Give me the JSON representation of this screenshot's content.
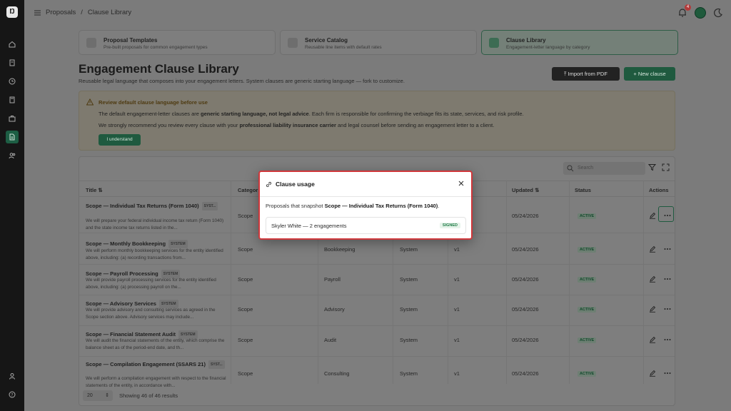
{
  "breadcrumb": {
    "root": "Proposals",
    "separator": "/",
    "current": "Clause Library"
  },
  "notifications": {
    "count": "4"
  },
  "tabs": [
    {
      "title": "Proposal Templates",
      "subtitle": "Pre-built proposals for common engagement types"
    },
    {
      "title": "Service Catalog",
      "subtitle": "Reusable line items with default rates"
    },
    {
      "title": "Clause Library",
      "subtitle": "Engagement-letter language by category",
      "active": true
    }
  ],
  "page": {
    "title": "Engagement Clause Library",
    "subtitle": "Reusable legal language that composes into your engagement letters. System clauses are generic starting language — fork to customize.",
    "import_label": "Import from PDF",
    "new_label": "New clause"
  },
  "warning": {
    "title": "Review default clause language before use",
    "p1_a": "The default engagement-letter clauses are ",
    "p1_b": "generic starting language, not legal advice",
    "p1_c": ". Each firm is responsible for confirming the verbiage fits its state, services, and risk profile.",
    "p2_a": "We strongly recommend you review every clause with your ",
    "p2_b": "professional liability insurance carrier",
    "p2_c": " and legal counsel before sending an engagement letter to a client.",
    "button": "I understand"
  },
  "table": {
    "search_placeholder": "Search",
    "headers": {
      "title": "Title ⇅",
      "category": "Categor",
      "updated": "Updated ⇅",
      "status": "Status",
      "actions": "Actions"
    },
    "rows": [
      {
        "title": "Scope — Individual Tax Returns (Form 1040)",
        "tag": "SYST...",
        "desc": "We will prepare your federal individual income tax return (Form 1040) and the state income tax returns listed in the...",
        "category": "Scope",
        "service": "",
        "owner": "",
        "version": "",
        "updated": "05/24/2026",
        "status": "ACTIVE"
      },
      {
        "title": "Scope — Monthly Bookkeeping",
        "tag": "SYSTEM",
        "desc": "We will perform monthly bookkeeping services for the entity identified above, including: (a) recording transactions from...",
        "category": "Scope",
        "service": "Bookkeeping",
        "owner": "System",
        "version": "v1",
        "updated": "05/24/2026",
        "status": "ACTIVE"
      },
      {
        "title": "Scope — Payroll Processing",
        "tag": "SYSTEM",
        "desc": "We will provide payroll processing services for the entity identified above, including: (a) processing payroll on the...",
        "category": "Scope",
        "service": "Payroll",
        "owner": "System",
        "version": "v1",
        "updated": "05/24/2026",
        "status": "ACTIVE"
      },
      {
        "title": "Scope — Advisory Services",
        "tag": "SYSTEM",
        "desc": "We will provide advisory and consulting services as agreed in the Scope section above. Advisory services may include...",
        "category": "Scope",
        "service": "Advisory",
        "owner": "System",
        "version": "v1",
        "updated": "05/24/2026",
        "status": "ACTIVE"
      },
      {
        "title": "Scope — Financial Statement Audit",
        "tag": "SYSTEM",
        "desc": "We will audit the financial statements of the entity, which comprise the balance sheet as of the period-end date, and th...",
        "category": "Scope",
        "service": "Audit",
        "owner": "System",
        "version": "v1",
        "updated": "05/24/2026",
        "status": "ACTIVE"
      },
      {
        "title": "Scope — Compilation Engagement (SSARS 21)",
        "tag": "SYST...",
        "desc": "We will perform a compilation engagement with respect to the financial statements of the entity, in accordance with...",
        "category": "Scope",
        "service": "Consulting",
        "owner": "System",
        "version": "v1",
        "updated": "05/24/2026",
        "status": "ACTIVE"
      }
    ],
    "page_size": "20",
    "showing": "Showing 46 of 46 results"
  },
  "modal": {
    "title": "Clause usage",
    "body_prefix": "Proposals that snapshot ",
    "body_bold": "Scope — Individual Tax Returns (Form 1040)",
    "body_suffix": ".",
    "item_name": "Skyler White — 2 engagements",
    "item_status": "SIGNED"
  }
}
